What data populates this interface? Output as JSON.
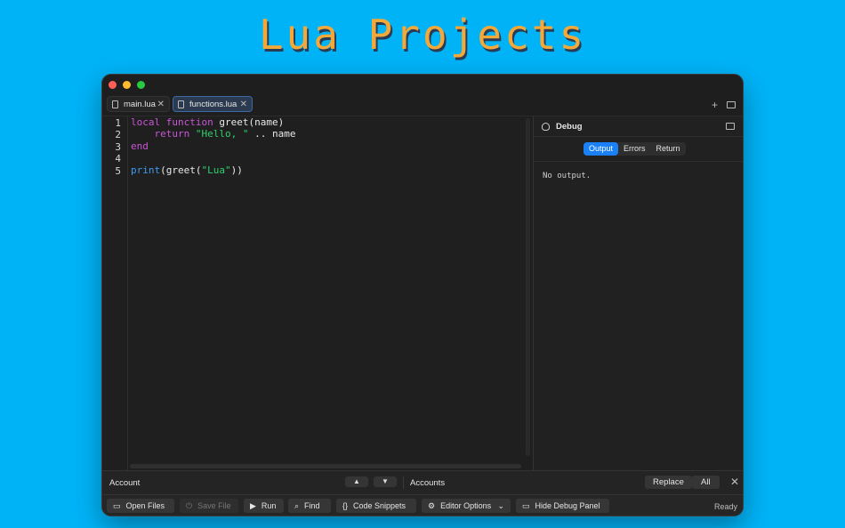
{
  "hero": {
    "title": "Lua Projects"
  },
  "tabs": [
    {
      "label": "main.lua",
      "active": false
    },
    {
      "label": "functions.lua",
      "active": true
    }
  ],
  "editor": {
    "line_numbers": [
      "1",
      "2",
      "3",
      "4",
      "5"
    ],
    "lines": [
      [
        {
          "t": "local",
          "c": "kw"
        },
        {
          "t": " "
        },
        {
          "t": "function",
          "c": "kw"
        },
        {
          "t": " greet(name)"
        }
      ],
      [
        {
          "t": "    "
        },
        {
          "t": "return",
          "c": "kw"
        },
        {
          "t": " "
        },
        {
          "t": "\"Hello, \"",
          "c": "str"
        },
        {
          "t": " .. name"
        }
      ],
      [
        {
          "t": "end",
          "c": "kw"
        }
      ],
      [
        {
          "t": ""
        }
      ],
      [
        {
          "t": "print",
          "c": "bi"
        },
        {
          "t": "(greet("
        },
        {
          "t": "\"Lua\"",
          "c": "str"
        },
        {
          "t": "))"
        }
      ]
    ]
  },
  "debug": {
    "title": "Debug",
    "tabs": [
      "Output",
      "Errors",
      "Return"
    ],
    "active_tab": "Output",
    "output_text": "No output."
  },
  "findbar": {
    "find_value": "Account",
    "replace_value": "Accounts",
    "replace_label": "Replace",
    "all_label": "All"
  },
  "toolbar": {
    "open_files": "Open Files",
    "save_file": "Save File",
    "run": "Run",
    "find": "Find",
    "code_snippets": "Code Snippets",
    "editor_options": "Editor Options",
    "hide_debug": "Hide Debug Panel",
    "status": "Ready"
  },
  "colors": {
    "background": "#00b3f7",
    "title": "#f2a93a",
    "accent": "#1a80f5",
    "keyword": "#c955d6",
    "string": "#2fcf6d",
    "builtin": "#3e9bf0"
  }
}
